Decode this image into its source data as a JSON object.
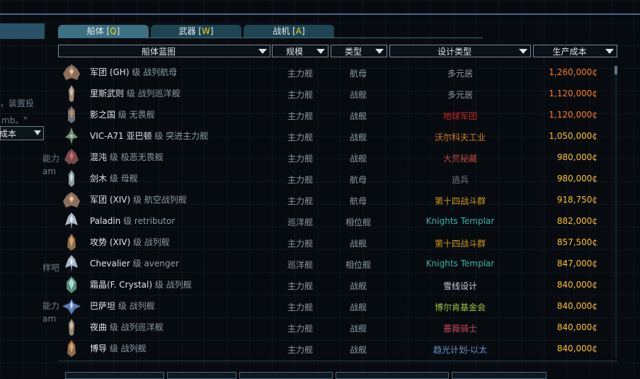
{
  "left_panel": {
    "fragments": [
      "，装置投",
      "mb。\"",
      "能力",
      "am",
      "样吧",
      "能力",
      "am"
    ],
    "select_label": "成本"
  },
  "tabs": [
    {
      "label": "船体 [",
      "hotkey": "Q",
      "close": "]",
      "active": true
    },
    {
      "label": "武器 [",
      "hotkey": "W",
      "close": "]",
      "active": false
    },
    {
      "label": "战机 [",
      "hotkey": "A",
      "close": "]",
      "active": false
    }
  ],
  "columns": {
    "blueprint": "船体蓝图",
    "scale": "规模",
    "type": "类型",
    "design": "设计类型",
    "cost": "生产成本"
  },
  "colors": {
    "多元居": "#8e9aa4",
    "地球军团": "#c8281e",
    "沃尔科夫工业": "#d47d16",
    "大荒秘藏": "#b6493c",
    "逃兵": "#6f7880",
    "第十四战斗群": "#d49a16",
    "Knights Templar": "#2fb6a4",
    "雪线设计": "#c9d1d8",
    "博尔肯基金会": "#9fc43a",
    "蔷薇骑士": "#d14a5a",
    "趋光计划-以太": "#6a94c8",
    "cost_orange": "#ff7a1a",
    "cost_yellow": "#ffc21a"
  },
  "ships": [
    {
      "cls": "军团 (GH)",
      "sfx": " 级 战列航母",
      "scale": "主力舰",
      "type": "航母",
      "design": "多元居",
      "cost": "1,260,000¢",
      "cost_color": "cost_orange",
      "icon": "carrier-ship-icon"
    },
    {
      "cls": "里斯武则",
      "sfx": " 级 战列巡洋舰",
      "scale": "主力舰",
      "type": "战舰",
      "design": "多元居",
      "cost": "1,120,000¢",
      "cost_color": "cost_orange",
      "icon": "cruiser-ship-icon"
    },
    {
      "cls": "影之国",
      "sfx": " 级 无畏舰",
      "scale": "主力舰",
      "type": "战舰",
      "design": "地球军团",
      "cost": "1,120,000¢",
      "cost_color": "cost_orange",
      "icon": "dreadnought-ship-icon"
    },
    {
      "cls": "VIC-A71 亚巴顿",
      "sfx": " 级 突进主力舰",
      "scale": "主力舰",
      "type": "战舰",
      "design": "沃尔科夫工业",
      "cost": "1,050,000¢",
      "cost_color": "cost_yellow",
      "icon": "assault-ship-icon"
    },
    {
      "cls": "混沌",
      "sfx": " 级 极恶无畏舰",
      "scale": "主力舰",
      "type": "战舰",
      "design": "大荒秘藏",
      "cost": "980,000¢",
      "cost_color": "cost_yellow",
      "icon": "chaos-ship-icon"
    },
    {
      "cls": "剑木",
      "sfx": " 级 母舰",
      "scale": "主力舰",
      "type": "航母",
      "design": "逃兵",
      "cost": "980,000¢",
      "cost_color": "cost_yellow",
      "icon": "mothership-icon"
    },
    {
      "cls": "军团 (XIV)",
      "sfx": " 级 航空战列舰",
      "scale": "主力舰",
      "type": "航母",
      "design": "第十四战斗群",
      "cost": "918,750¢",
      "cost_color": "cost_yellow",
      "icon": "carrier-ship-icon"
    },
    {
      "cls": "Paladin",
      "sfx": " 级 retributor",
      "scale": "巡洋舰",
      "type": "相位舰",
      "design": "Knights Templar",
      "cost": "882,000¢",
      "cost_color": "cost_yellow",
      "icon": "phase-ship-icon"
    },
    {
      "cls": "攻势 (XIV)",
      "sfx": " 级 战列舰",
      "scale": "主力舰",
      "type": "战舰",
      "design": "第十四战斗群",
      "cost": "857,500¢",
      "cost_color": "cost_yellow",
      "icon": "battleship-icon"
    },
    {
      "cls": "Chevalier",
      "sfx": " 级 avenger",
      "scale": "巡洋舰",
      "type": "相位舰",
      "design": "Knights Templar",
      "cost": "847,000¢",
      "cost_color": "cost_yellow",
      "icon": "phase-ship-icon"
    },
    {
      "cls": "霜晶(F. Crystal)",
      "sfx": " 级 战列舰",
      "scale": "主力舰",
      "type": "战舰",
      "design": "雪线设计",
      "cost": "840,000¢",
      "cost_color": "cost_yellow",
      "icon": "crystal-ship-icon"
    },
    {
      "cls": "巴萨坦",
      "sfx": " 级 战列舰",
      "scale": "主力舰",
      "type": "战舰",
      "design": "博尔肯基金会",
      "cost": "840,000¢",
      "cost_color": "cost_yellow",
      "icon": "winged-ship-icon"
    },
    {
      "cls": "夜曲",
      "sfx": " 级 战列巡洋舰",
      "scale": "主力舰",
      "type": "战舰",
      "design": "蔷薇骑士",
      "cost": "840,000¢",
      "cost_color": "cost_yellow",
      "icon": "cruiser-ship-icon"
    },
    {
      "cls": "博导",
      "sfx": " 级 战列舰",
      "scale": "主力舰",
      "type": "战舰",
      "design": "趋光计划-以太",
      "cost": "840,000¢",
      "cost_color": "cost_yellow",
      "icon": "battleship-icon"
    }
  ]
}
